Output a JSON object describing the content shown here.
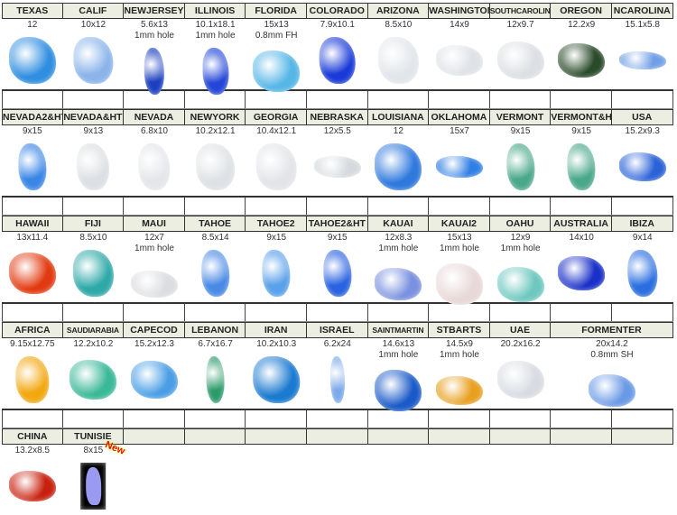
{
  "rows": [
    [
      {
        "name": "TEXAS",
        "dims": "12",
        "color": "#2f8ee0"
      },
      {
        "name": "CALIF",
        "dims": "10x12",
        "color": "#8ab4ea"
      },
      {
        "name": "NEWJERSEY",
        "dims": "5.6x13",
        "note": "1mm hole",
        "color": "#1a3fc0"
      },
      {
        "name": "ILLINOIS",
        "dims": "10.1x18.1",
        "note": "1mm hole",
        "color": "#2346d8"
      },
      {
        "name": "FLORIDA",
        "dims": "15x13",
        "note": "0.8mm FH",
        "color": "#56b6e6"
      },
      {
        "name": "COLORADO",
        "dims": "7.9x10.1",
        "color": "#1a3ad8"
      },
      {
        "name": "ARIZONA",
        "dims": "8.5x10",
        "color": "#e2e6ea"
      },
      {
        "name": "WASHINGTON",
        "dims": "14x9",
        "color": "#dfe2e6"
      },
      {
        "name": "SOUTHCAROLINA",
        "dims": "12x9.7",
        "color": "#dcdfe3"
      },
      {
        "name": "OREGON",
        "dims": "12.2x9",
        "color": "#2a4a2a"
      },
      {
        "name": "NCAROLINA",
        "dims": "15.1x5.8",
        "color": "#6f9ee6"
      }
    ],
    [
      {
        "name": "NEVADA2&HT",
        "dims": "9x15",
        "color": "#3a86e6"
      },
      {
        "name": "NEVADA&HT",
        "dims": "9x13",
        "color": "#dcdfe3"
      },
      {
        "name": "NEVADA",
        "dims": "6.8x10",
        "color": "#e4e6ea"
      },
      {
        "name": "NEWYORK",
        "dims": "10.2x12.1",
        "color": "#dee1e5"
      },
      {
        "name": "GEORGIA",
        "dims": "10.4x12.1",
        "color": "#e2e4e8"
      },
      {
        "name": "NEBRASKA",
        "dims": "12x5.5",
        "color": "#d6dade"
      },
      {
        "name": "LOUISIANA",
        "dims": "12",
        "color": "#2e78de"
      },
      {
        "name": "OKLAHOMA",
        "dims": "15x7",
        "color": "#2f7fe4"
      },
      {
        "name": "VERMONT",
        "dims": "9x15",
        "color": "#4aa88a"
      },
      {
        "name": "VERMONT&HT",
        "dims": "9x15",
        "color": "#4aa88a"
      },
      {
        "name": "USA",
        "dims": "15.2x9.3",
        "color": "#2a62d8"
      }
    ],
    [
      {
        "name": "HAWAII",
        "dims": "13x11.4",
        "color": "#e23a10"
      },
      {
        "name": "FIJI",
        "dims": "8.5x10",
        "color": "#2ea8a8"
      },
      {
        "name": "MAUI",
        "dims": "12x7",
        "note": "1mm hole",
        "color": "#dcdde0"
      },
      {
        "name": "TAHOE",
        "dims": "8.5x14",
        "color": "#4a8ae6"
      },
      {
        "name": "TAHOE2",
        "dims": "9x15",
        "color": "#5aa0ea"
      },
      {
        "name": "TAHOE2&HT",
        "dims": "9x15",
        "color": "#2a62e0"
      },
      {
        "name": "KAUAI",
        "dims": "12x8.3",
        "note": "1mm hole",
        "color": "#7a90e0"
      },
      {
        "name": "KAUAI2",
        "dims": "15x13",
        "note": "1mm hole",
        "color": "#e8d8d8"
      },
      {
        "name": "OAHU",
        "dims": "12x9",
        "note": "1mm hole",
        "color": "#6ec8c0"
      },
      {
        "name": "AUSTRALIA",
        "dims": "14x10",
        "color": "#1a30c8"
      },
      {
        "name": "IBIZA",
        "dims": "9x14",
        "color": "#2a6ee0"
      }
    ],
    [
      {
        "name": "AFRICA",
        "dims": "9.15x12.75",
        "color": "#f2a810"
      },
      {
        "name": "SAUDIARABIA",
        "dims": "12.2x10.2",
        "color": "#3ab898"
      },
      {
        "name": "CAPECOD",
        "dims": "15.2x12.3",
        "color": "#4a9ee6"
      },
      {
        "name": "LEBANON",
        "dims": "6.7x16.7",
        "color": "#2a9a6a"
      },
      {
        "name": "IRAN",
        "dims": "10.2x10.3",
        "color": "#1a7ad0"
      },
      {
        "name": "ISRAEL",
        "dims": "6.2x24",
        "color": "#7aa8e8"
      },
      {
        "name": "SAINTMARTIN",
        "dims": "14.6x13",
        "note": "1mm hole",
        "color": "#1a5ac8"
      },
      {
        "name": "STBARTS",
        "dims": "14.5x9",
        "note": "1mm hole",
        "color": "#e8a020"
      },
      {
        "name": "UAE",
        "dims": "20.2x16.2",
        "color": "#d8dce2"
      },
      {
        "name": "FORMENTER",
        "dims": "20x14.2",
        "note": "0.8mm SH",
        "color": "#6a9ae6",
        "span": 2
      }
    ],
    [
      {
        "name": "CHINA",
        "dims": "13.2x8.5",
        "color": "#c8200e"
      },
      {
        "name": "TUNISIE",
        "dims": "8x15",
        "color": "#9a9af0",
        "badge": "New"
      }
    ]
  ]
}
